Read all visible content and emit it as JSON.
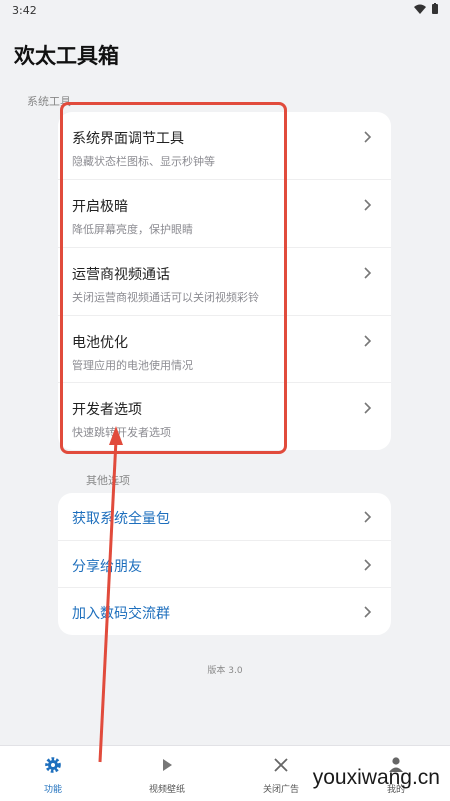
{
  "status": {
    "time": "3:42"
  },
  "app": {
    "title": "欢太工具箱"
  },
  "sections": {
    "system": "系统工具",
    "other": "其他选项"
  },
  "system_items": [
    {
      "title": "系统界面调节工具",
      "subtitle": "隐藏状态栏图标、显示秒钟等"
    },
    {
      "title": "开启极暗",
      "subtitle": "降低屏幕亮度，保护眼睛"
    },
    {
      "title": "运营商视频通话",
      "subtitle": "关闭运营商视频通话可以关闭视频彩铃"
    },
    {
      "title": "电池优化",
      "subtitle": "管理应用的电池使用情况"
    },
    {
      "title": "开发者选项",
      "subtitle": "快速跳转开发者选项"
    }
  ],
  "other_items": [
    {
      "title": "获取系统全量包"
    },
    {
      "title": "分享给朋友"
    },
    {
      "title": "加入数码交流群"
    }
  ],
  "version": "版本 3.0",
  "nav": [
    {
      "label": "功能",
      "icon": "gear-icon",
      "active": true
    },
    {
      "label": "视频壁纸",
      "icon": "play-icon",
      "active": false
    },
    {
      "label": "关闭广告",
      "icon": "close-icon",
      "active": false
    },
    {
      "label": "我的",
      "icon": "person-icon",
      "active": false
    }
  ],
  "watermark": "youxiwang.cn",
  "colors": {
    "accent": "#1e6fbd",
    "highlight": "#e14b3c",
    "background": "#f1f2f4"
  }
}
